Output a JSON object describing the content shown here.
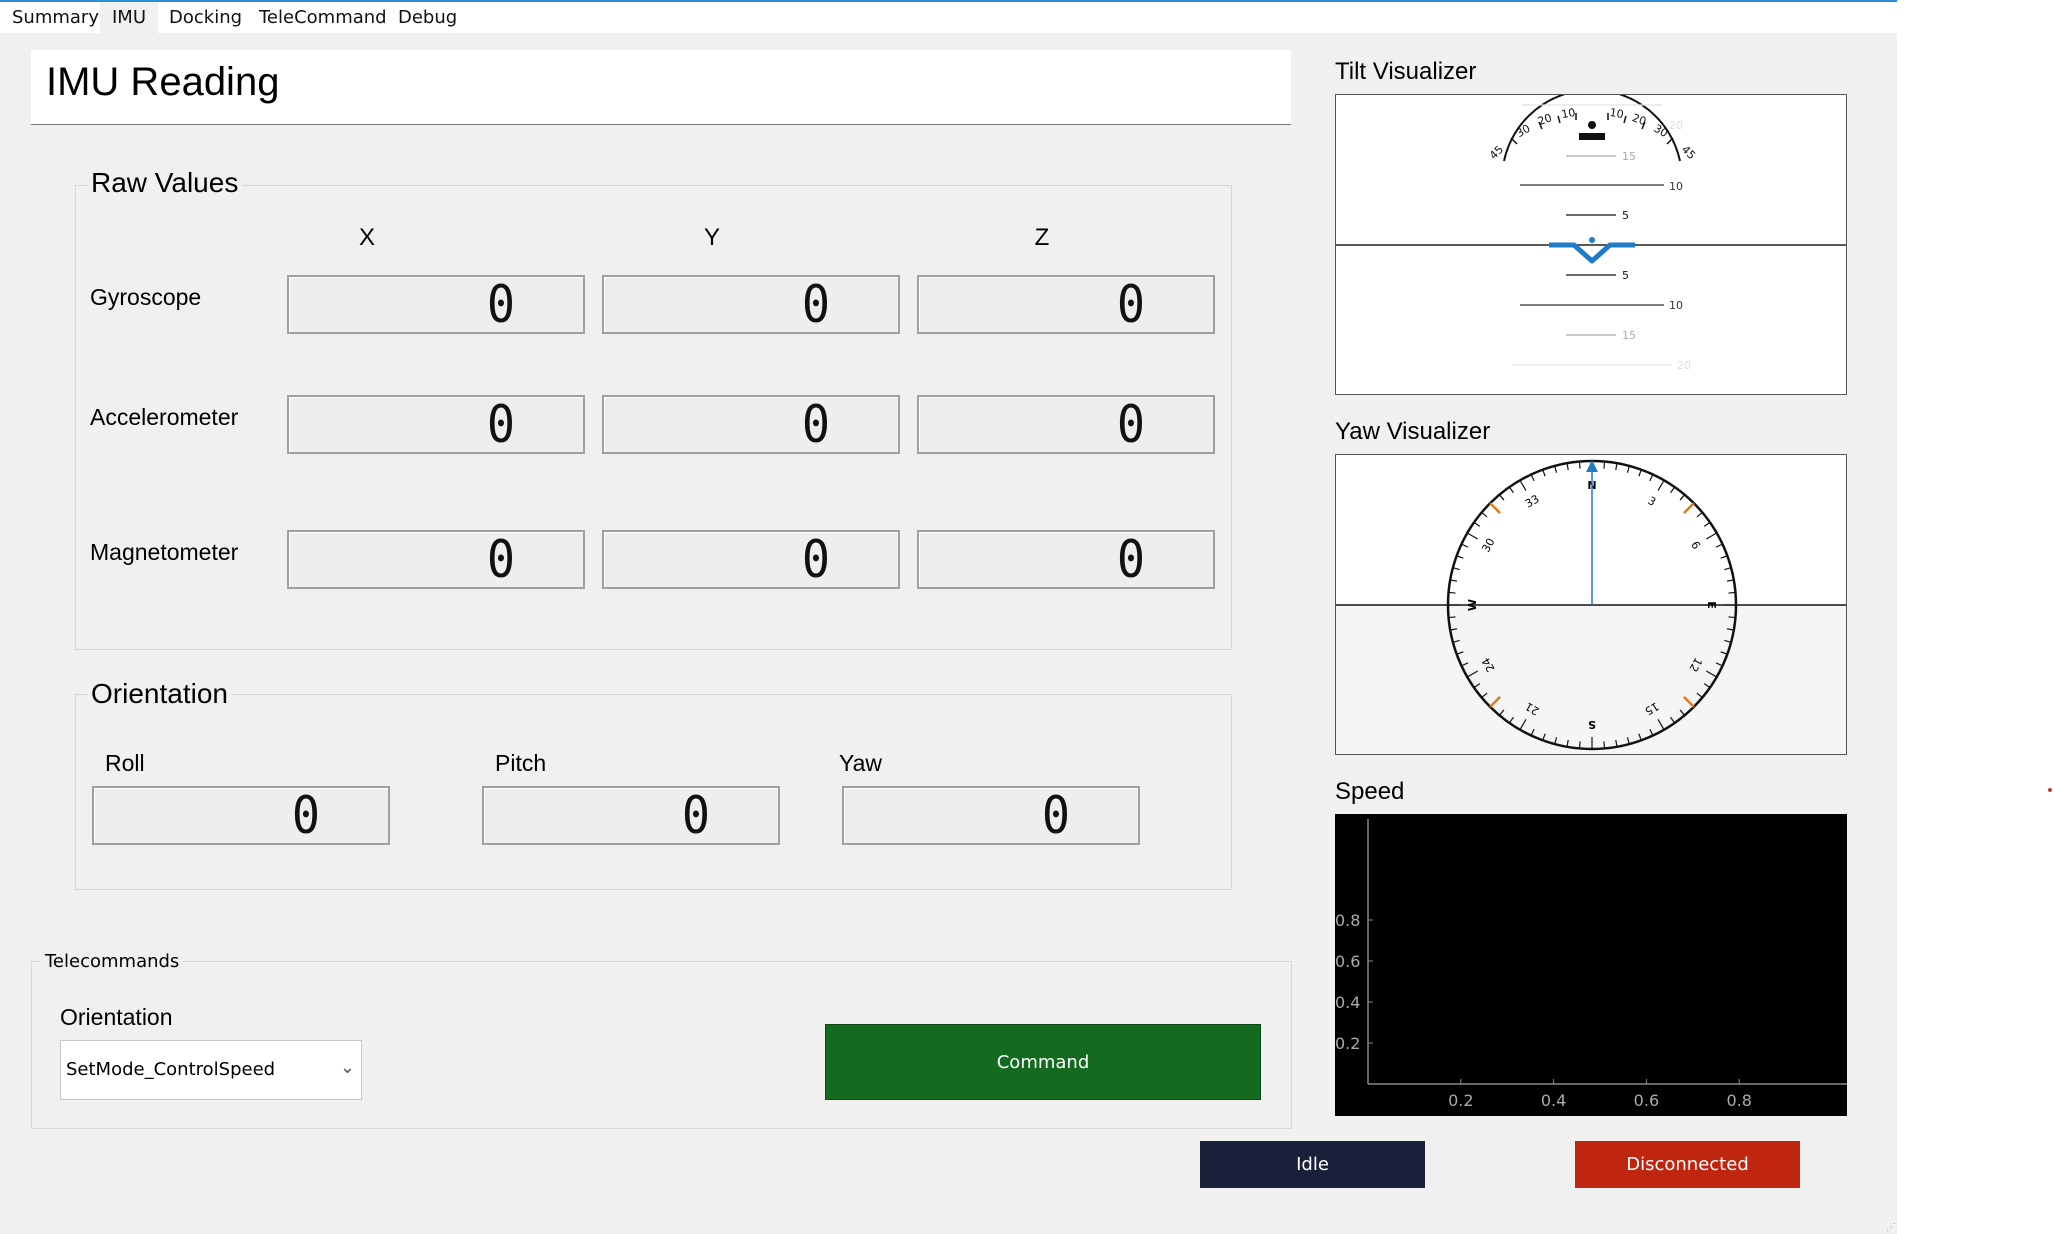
{
  "tabs": [
    "Summary",
    "IMU",
    "Docking",
    "TeleCommand",
    "Debug"
  ],
  "active_tab": "IMU",
  "page_title": "IMU Reading",
  "raw_values": {
    "title": "Raw Values",
    "columns": [
      "X",
      "Y",
      "Z"
    ],
    "rows": [
      {
        "label": "Gyroscope",
        "values": [
          "0",
          "0",
          "0"
        ]
      },
      {
        "label": "Accelerometer",
        "values": [
          "0",
          "0",
          "0"
        ]
      },
      {
        "label": "Magnetometer",
        "values": [
          "0",
          "0",
          "0"
        ]
      }
    ]
  },
  "orientation": {
    "title": "Orientation",
    "fields": [
      {
        "label": "Roll",
        "value": "0"
      },
      {
        "label": "Pitch",
        "value": "0"
      },
      {
        "label": "Yaw",
        "value": "0"
      }
    ]
  },
  "tilt_visualizer": {
    "title": "Tilt Visualizer",
    "roll_deg": 0,
    "pitch_deg": 0,
    "arc_labels_left": [
      "45",
      "30",
      "20",
      "10"
    ],
    "arc_labels_right": [
      "10",
      "20",
      "30",
      "45"
    ],
    "pitch_labels": [
      "20",
      "15",
      "10",
      "5",
      "5",
      "10",
      "15",
      "20"
    ]
  },
  "yaw_visualizer": {
    "title": "Yaw Visualizer",
    "heading_deg": 0,
    "cardinals": [
      "N",
      "E",
      "S",
      "W"
    ],
    "numbers": [
      "3",
      "6",
      "12",
      "15",
      "21",
      "24",
      "30",
      "33"
    ]
  },
  "speed": {
    "title": "Speed",
    "chart_data": {
      "type": "line",
      "series": [],
      "x_ticks": [
        "0.2",
        "0.4",
        "0.6",
        "0.8"
      ],
      "y_ticks": [
        "0.8",
        "0.6",
        "0.4",
        "0.2"
      ],
      "xlim": [
        0,
        1
      ],
      "ylim": [
        0,
        1
      ]
    }
  },
  "telecommands": {
    "title": "Telecommands",
    "orientation_label": "Orientation",
    "selected_mode": "SetMode_ControlSpeed",
    "command_label": "Command"
  },
  "status": {
    "state_label": "Idle",
    "connection_label": "Disconnected"
  },
  "colors": {
    "command_button": "#146b1f",
    "idle_button": "#1a1f3a",
    "disconnected_button": "#c0250f",
    "accent": "#1f7ac8"
  }
}
